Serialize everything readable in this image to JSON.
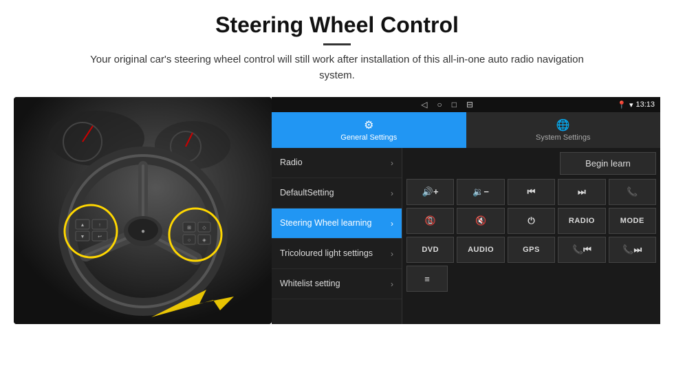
{
  "header": {
    "title": "Steering Wheel Control",
    "divider": true,
    "description": "Your original car's steering wheel control will still work after installation of this all-in-one auto radio navigation system."
  },
  "status_bar": {
    "time": "13:13",
    "nav_icons": [
      "◁",
      "○",
      "□",
      "⊟"
    ]
  },
  "tabs": [
    {
      "id": "general",
      "label": "General Settings",
      "icon": "⚙",
      "active": true
    },
    {
      "id": "system",
      "label": "System Settings",
      "icon": "🌐",
      "active": false
    }
  ],
  "menu_items": [
    {
      "id": "radio",
      "label": "Radio",
      "active": false
    },
    {
      "id": "default",
      "label": "DefaultSetting",
      "active": false
    },
    {
      "id": "steering",
      "label": "Steering Wheel learning",
      "active": true
    },
    {
      "id": "tricoloured",
      "label": "Tricoloured light settings",
      "active": false
    },
    {
      "id": "whitelist",
      "label": "Whitelist setting",
      "active": false
    }
  ],
  "panel": {
    "begin_learn_label": "Begin learn",
    "controls_row1": [
      {
        "id": "vol_up",
        "symbol": "🔊+",
        "label": "vol-up"
      },
      {
        "id": "vol_down",
        "symbol": "🔉-",
        "label": "vol-down"
      },
      {
        "id": "prev_track",
        "symbol": "⏮",
        "label": "prev-track"
      },
      {
        "id": "next_track",
        "symbol": "⏭",
        "label": "next-track"
      },
      {
        "id": "phone",
        "symbol": "📞",
        "label": "phone"
      }
    ],
    "controls_row2": [
      {
        "id": "hang_up",
        "symbol": "📵",
        "label": "hang-up"
      },
      {
        "id": "mute",
        "symbol": "🔇",
        "label": "mute"
      },
      {
        "id": "power",
        "symbol": "⏻",
        "label": "power"
      },
      {
        "id": "radio_btn",
        "symbol": "RADIO",
        "label": "radio-btn",
        "text": true
      },
      {
        "id": "mode_btn",
        "symbol": "MODE",
        "label": "mode-btn",
        "text": true
      }
    ],
    "controls_row3": [
      {
        "id": "dvd_btn",
        "symbol": "DVD",
        "label": "dvd-btn",
        "text": true
      },
      {
        "id": "audio_btn",
        "symbol": "AUDIO",
        "label": "audio-btn",
        "text": true
      },
      {
        "id": "gps_btn",
        "symbol": "GPS",
        "label": "gps-btn",
        "text": true
      },
      {
        "id": "tel_prev",
        "symbol": "📞⏮",
        "label": "tel-prev"
      },
      {
        "id": "tel_next",
        "symbol": "📞⏭",
        "label": "tel-next"
      }
    ],
    "controls_row4": [
      {
        "id": "menu_icon",
        "symbol": "≡",
        "label": "menu-icon"
      }
    ]
  }
}
